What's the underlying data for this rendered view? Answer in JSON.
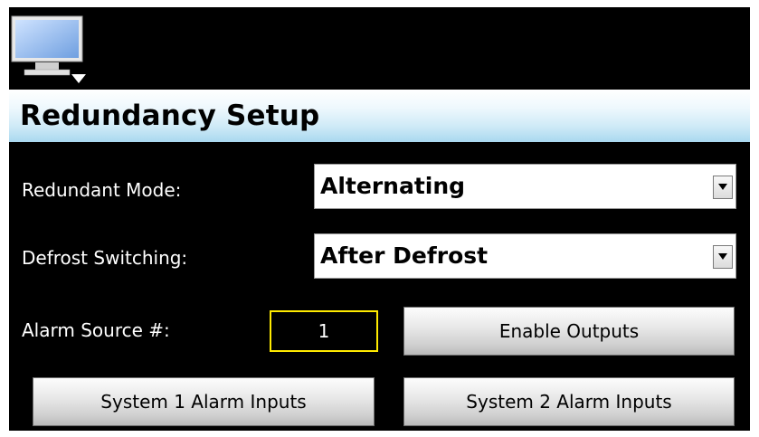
{
  "header": {
    "monitor_icon": "monitor-dropdown-icon"
  },
  "title": "Redundancy Setup",
  "redundant_mode": {
    "label": "Redundant Mode:",
    "value": "Alternating"
  },
  "defrost_switching": {
    "label": "Defrost Switching:",
    "value": "After Defrost"
  },
  "alarm_source": {
    "label": "Alarm Source #:",
    "value": "1"
  },
  "buttons": {
    "enable_outputs": "Enable Outputs",
    "system1_alarm_inputs": "System 1 Alarm Inputs",
    "system2_alarm_inputs": "System 2 Alarm Inputs"
  },
  "colors": {
    "background": "#000000",
    "title_gradient_bottom": "#a9d8ef",
    "numbox_border": "#ffea00"
  }
}
